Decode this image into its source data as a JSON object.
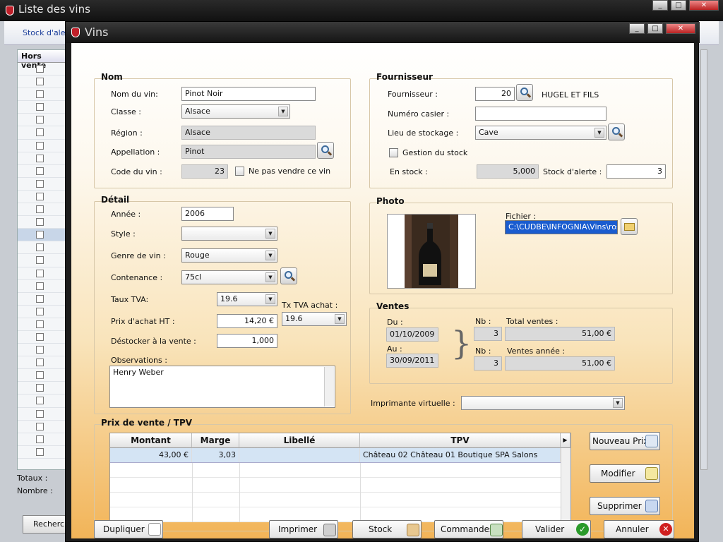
{
  "background_window": {
    "title": "Liste des vins",
    "link": "Stock d'alerte",
    "grid_header": "Hors vente",
    "totaux_label": "Totaux :",
    "nombre_label": "Nombre :",
    "search_button": "Recherc"
  },
  "window": {
    "title": "Vins"
  },
  "nom": {
    "section": "Nom",
    "nom_du_vin_label": "Nom du vin:",
    "nom_du_vin_value": "Pinot Noir",
    "classe_label": "Classe :",
    "classe_value": "Alsace",
    "region_label": "Région :",
    "region_value": "Alsace",
    "appellation_label": "Appellation :",
    "appellation_value": "Pinot",
    "code_label": "Code du vin :",
    "code_value": "23",
    "ne_pas_vendre_label": "Ne pas vendre ce vin"
  },
  "fournisseur": {
    "section": "Fournisseur",
    "fournisseur_label": "Fournisseur :",
    "fournisseur_value": "20",
    "fournisseur_name": "HUGEL ET FILS",
    "casier_label": "Numéro casier :",
    "casier_value": "",
    "lieu_label": "Lieu de stockage :",
    "lieu_value": "Cave",
    "gestion_label": "Gestion du stock",
    "en_stock_label": "En stock :",
    "en_stock_value": "5,000",
    "alerte_label": "Stock d'alerte :",
    "alerte_value": "3"
  },
  "detail": {
    "section": "Détail",
    "annee_label": "Année :",
    "annee_value": "2006",
    "style_label": "Style :",
    "style_value": "",
    "genre_label": "Genre de vin :",
    "genre_value": "Rouge",
    "contenance_label": "Contenance :",
    "contenance_value": "75cl",
    "tva_label": "Taux TVA:",
    "tva_value": "19.6",
    "tx_tva_achat_label": "Tx TVA achat :",
    "tx_tva_achat_value": "19.6",
    "prix_achat_label": "Prix d'achat HT :",
    "prix_achat_value": "14,20 €",
    "destocker_label": "Déstocker à la vente :",
    "destocker_value": "1,000",
    "observations_label": "Observations :",
    "observations_value": "Henry Weber"
  },
  "photo": {
    "section": "Photo",
    "fichier_label": "Fichier :",
    "fichier_value": "C:\\CUDBE\\INFOGNIA\\Vins\\rosé."
  },
  "ventes": {
    "section": "Ventes",
    "du_label": "Du :",
    "du_value": "01/10/2009",
    "au_label": "Au :",
    "au_value": "30/09/2011",
    "nb_label": "Nb :",
    "nb_total_value": "3",
    "total_label": "Total ventes :",
    "total_value": "51,00 €",
    "nb2_label": "Nb :",
    "nb_annee_value": "3",
    "annee_label": "Ventes année :",
    "annee_value": "51,00 €"
  },
  "imprimante": {
    "label": "Imprimante virtuelle :",
    "value": ""
  },
  "prix_vente": {
    "section": "Prix de vente / TPV",
    "columns": [
      "Montant",
      "Marge",
      "Libellé",
      "TPV"
    ],
    "rows": [
      {
        "montant": "43,00 €",
        "marge": "3,03",
        "libelle": "",
        "tpv": "Château 02 Château 01 Boutique SPA Salons"
      }
    ],
    "nouveau_prix": "Nouveau Prix",
    "modifier": "Modifier",
    "supprimer": "Supprimer"
  },
  "footer": {
    "dupliquer": "Dupliquer",
    "imprimer": "Imprimer",
    "stock": "Stock",
    "commandes": "Commandes",
    "valider": "Valider",
    "annuler": "Annuler"
  },
  "colors": {
    "accent_selection": "#1a5ccf",
    "valider_icon": "#2a9a2a",
    "annuler_icon": "#d02020"
  }
}
